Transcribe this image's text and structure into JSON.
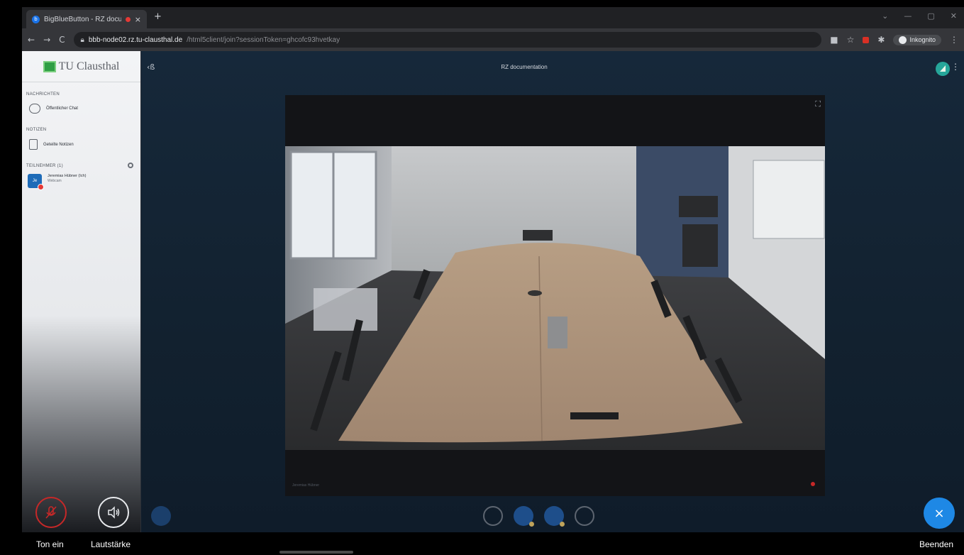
{
  "browser": {
    "tab_title": "BigBlueButton - RZ docume...",
    "tab_close": "×",
    "new_tab": "+",
    "window_controls": [
      "⌄",
      "—",
      "▢",
      "✕"
    ],
    "nav": {
      "back": "←",
      "forward": "→",
      "reload": "C"
    },
    "url_host": "bbb-node02.rz.tu-clausthal.de",
    "url_path": "/html5client/join?sessionToken=ghcofc93hvetkay",
    "incognito_label": "Inkognito",
    "menu": "⋮"
  },
  "sidebar": {
    "brand_name": "TU Clausthal",
    "sections": {
      "messages": "NACHRICHTEN",
      "notes": "NOTIZEN",
      "participants": "TEILNEHMER (1)"
    },
    "public_chat": "Öffentlicher Chat",
    "shared_notes": "Geteilte Notizen",
    "participant": {
      "initials": "Je",
      "name": "Jeremias Hübner (Ich)",
      "status": "Webcam"
    }
  },
  "main": {
    "users_toggle": "‹ß",
    "meeting_title": "RZ documentation",
    "more": "⋮",
    "fullscreen": "⛶",
    "video_label": "Jeremias Hübner"
  },
  "overlay": {
    "unmute_label": "Ton ein",
    "volume_label": "Lautstärke",
    "end_label": "Beenden",
    "end_icon": "×"
  },
  "colors": {
    "accent": "#1e88e5",
    "danger": "#c62828",
    "connection": "#26a69a"
  }
}
